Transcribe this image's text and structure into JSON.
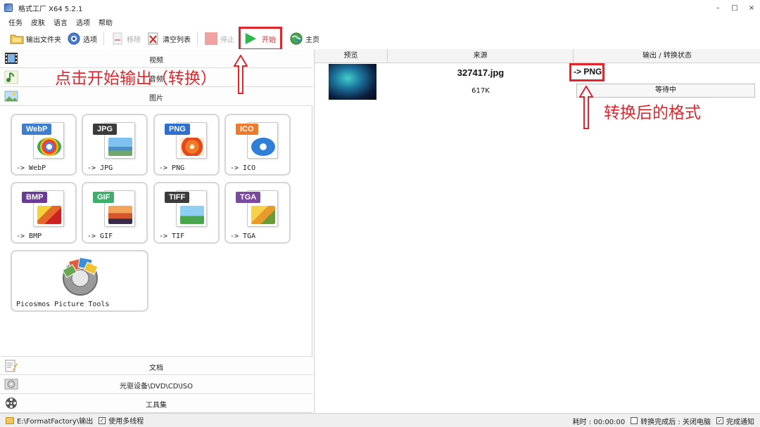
{
  "window": {
    "title": "格式工厂 X64 5.2.1",
    "minimize": "–",
    "maximize": "□",
    "close": "×"
  },
  "menu": [
    "任务",
    "皮肤",
    "语言",
    "选项",
    "帮助"
  ],
  "toolbar": {
    "output_folder": "输出文件夹",
    "options": "选项",
    "remove": "移除",
    "clear_list": "清空列表",
    "stop": "停止",
    "start": "开始",
    "home": "主页"
  },
  "categories": {
    "video": "视频",
    "audio": "音频",
    "image": "图片",
    "document": "文档",
    "optical": "光驱设备\\DVD\\CD\\ISO",
    "tools": "工具集"
  },
  "image_formats": [
    {
      "badge": "WebP",
      "caption": "-> WebP",
      "color": "#3c7fd1"
    },
    {
      "badge": "JPG",
      "caption": "-> JPG",
      "color": "#3b3b3b"
    },
    {
      "badge": "PNG",
      "caption": "-> PNG",
      "color": "#2d6fd0"
    },
    {
      "badge": "ICO",
      "caption": "-> ICO",
      "color": "#ee7a2a"
    },
    {
      "badge": "BMP",
      "caption": "-> BMP",
      "color": "#6a3c96"
    },
    {
      "badge": "GIF",
      "caption": "-> GIF",
      "color": "#3fae6a"
    },
    {
      "badge": "TIFF",
      "caption": "-> TIF",
      "color": "#3b3b3b"
    },
    {
      "badge": "TGA",
      "caption": "-> TGA",
      "color": "#7a4aa0"
    }
  ],
  "tool_tile": {
    "caption": "Picosmos Picture Tools"
  },
  "table": {
    "headers": [
      "预览",
      "来源",
      "输出 / 转换状态"
    ],
    "rows": [
      {
        "source": "327417.jpg",
        "size": "617K",
        "output": "-> PNG",
        "status": "等待中"
      }
    ]
  },
  "annotations": {
    "left": "点击开始输出（转换）",
    "right": "转换后的格式"
  },
  "statusbar": {
    "path": "E:\\FormatFactory\\输出",
    "multithread": "使用多线程",
    "elapsed": "耗时 : 00:00:00",
    "after_done": "转换完成后 : 关闭电脑",
    "notify": "完成通知",
    "check": "✓"
  },
  "colors": {
    "accent_red": "#e0252b",
    "start_green": "#2db84a"
  }
}
